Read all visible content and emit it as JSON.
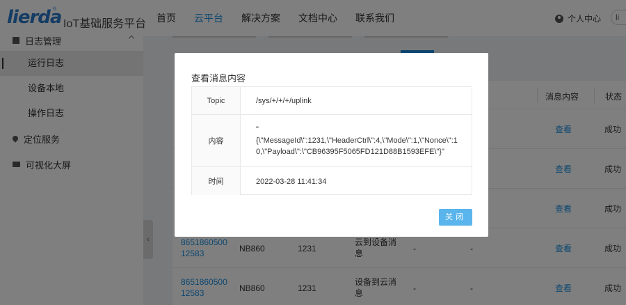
{
  "header": {
    "logo": "lierda",
    "logo_reg": "®",
    "platform": "IoT基础服务平台",
    "nav": [
      "首页",
      "云平台",
      "解决方案",
      "文档中心",
      "联系我们"
    ],
    "nav_active": 1,
    "user_label": "个人中心",
    "lang": "li"
  },
  "sidebar": {
    "group_log": "日志管理",
    "items": [
      "运行日志",
      "设备本地",
      "操作日志"
    ],
    "group_location": "定位服务",
    "group_screen": "可视化大屏",
    "collapse_glyph": "‹"
  },
  "table": {
    "headers": {
      "content": "消息内容",
      "status": "状态"
    },
    "rows": [
      {
        "view": "查看",
        "status": "成功"
      },
      {
        "view": "查看",
        "status": "成功"
      },
      {
        "view": "查看",
        "status": "成功"
      },
      {
        "imei_1": "8651860500",
        "imei_2": "12583",
        "type": "NB860",
        "id": "1231",
        "dir_1": "云到设备消",
        "dir_2": "息",
        "c1": "-",
        "c2": "-",
        "view": "查看",
        "status": "成功"
      },
      {
        "imei_1": "8651860500",
        "imei_2": "12583",
        "type": "NB860",
        "id": "1231",
        "dir_1": "设备到云消",
        "dir_2": "息",
        "c1": "-",
        "c2": "-",
        "view": "查看",
        "status": "成功"
      }
    ]
  },
  "modal": {
    "title": "查看消息内容",
    "topic_label": "Topic",
    "topic_value": "/sys/+/+/+/uplink",
    "content_label": "内容",
    "content_line1": "\"",
    "content_line2": "{\\\"MessageId\\\":1231,\\\"HeaderCtrl\\\":4,\\\"Mode\\\":1,\\\"Nonce\\\":1",
    "content_line3": "0,\\\"Payload\\\":\\\"CB96395F5065FD121D88B1593EFE\\\"}\"",
    "time_label": "时间",
    "time_value": "2022-03-28 11:41:34",
    "close_label": "关闭"
  }
}
